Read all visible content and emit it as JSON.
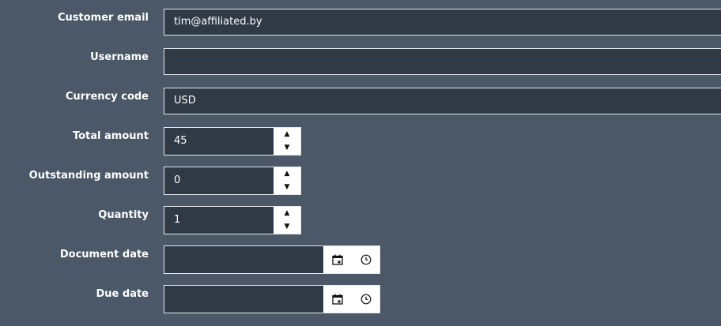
{
  "form": {
    "customer_email": {
      "label": "Customer email",
      "value": "tim@affiliated.by"
    },
    "username": {
      "label": "Username",
      "value": ""
    },
    "currency_code": {
      "label": "Currency code",
      "value": "USD"
    },
    "total_amount": {
      "label": "Total amount",
      "value": "45"
    },
    "outstanding_amount": {
      "label": "Outstanding amount",
      "value": "0"
    },
    "quantity": {
      "label": "Quantity",
      "value": "1"
    },
    "document_date": {
      "label": "Document date",
      "value": ""
    },
    "due_date": {
      "label": "Due date",
      "value": ""
    }
  },
  "icons": {
    "spin_up": "▲",
    "spin_down": "▼",
    "calendar": "calendar-icon",
    "clock": "clock-icon"
  },
  "colors": {
    "background": "#4a5867",
    "field_background": "#2f3a46",
    "border": "#e6e9ed",
    "text": "#ffffff"
  }
}
